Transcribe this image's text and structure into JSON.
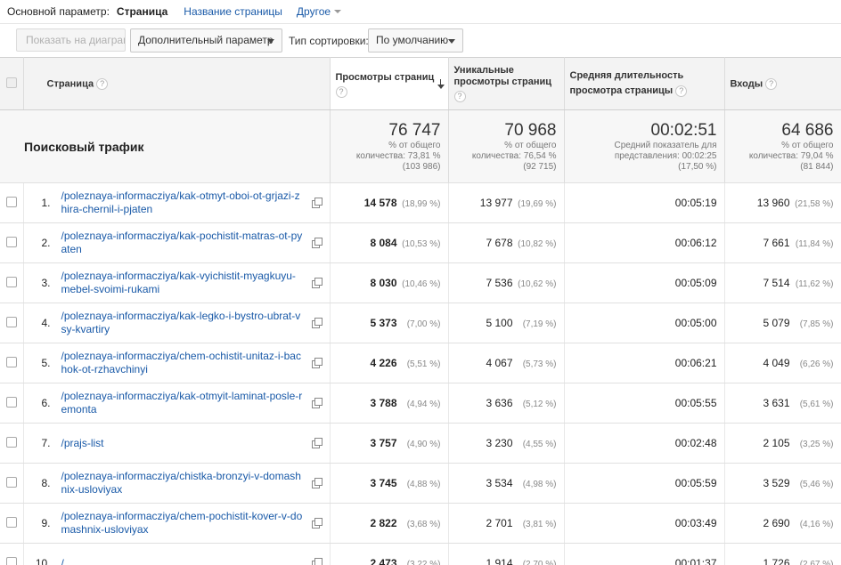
{
  "primary_dimension": {
    "label": "Основной параметр:",
    "active": "Страница",
    "link_title": "Название страницы",
    "other": "Другое"
  },
  "toolbar": {
    "show_on_chart": "Показать на диаграмме",
    "secondary_dimension": "Дополнительный параметр",
    "sort_type_label": "Тип сортировки:",
    "sort_type_value": "По умолчанию"
  },
  "columns": {
    "page": "Страница",
    "pageviews": "Просмотры страниц",
    "unique_pageviews": "Уникальные просмотры страниц",
    "avg_time": "Средняя длительность просмотра страницы",
    "entrances": "Входы"
  },
  "summary": {
    "title": "Поисковый трафик",
    "pageviews": {
      "value": "76 747",
      "sub1": "% от общего",
      "sub2": "количества: 73,81 %",
      "sub3": "(103 986)"
    },
    "unique": {
      "value": "70 968",
      "sub1": "% от общего",
      "sub2": "количества: 76,54 %",
      "sub3": "(92 715)"
    },
    "avg_time": {
      "value": "00:02:51",
      "sub1": "Средний показатель для",
      "sub2": "представления: 00:02:25",
      "sub3": "(17,50 %)"
    },
    "entrances": {
      "value": "64 686",
      "sub1": "% от общего",
      "sub2": "количества: 79,04 %",
      "sub3": "(81 844)"
    }
  },
  "rows": [
    {
      "num": "1.",
      "page": "/poleznaya-informacziya/kak-otmyt-oboi-ot-grjazi-zhira-chernil-i-pjaten",
      "pv": "14 578",
      "pv_pct": "(18,99 %)",
      "upv": "13 977",
      "upv_pct": "(19,69 %)",
      "time": "00:05:19",
      "ent": "13 960",
      "ent_pct": "(21,58 %)"
    },
    {
      "num": "2.",
      "page": "/poleznaya-informacziya/kak-pochistit-matras-ot-pyaten",
      "pv": "8 084",
      "pv_pct": "(10,53 %)",
      "upv": "7 678",
      "upv_pct": "(10,82 %)",
      "time": "00:06:12",
      "ent": "7 661",
      "ent_pct": "(11,84 %)"
    },
    {
      "num": "3.",
      "page": "/poleznaya-informacziya/kak-vyichistit-myagkuyu-mebel-svoimi-rukami",
      "pv": "8 030",
      "pv_pct": "(10,46 %)",
      "upv": "7 536",
      "upv_pct": "(10,62 %)",
      "time": "00:05:09",
      "ent": "7 514",
      "ent_pct": "(11,62 %)"
    },
    {
      "num": "4.",
      "page": "/poleznaya-informacziya/kak-legko-i-bystro-ubrat-vsy-kvartiry",
      "pv": "5 373",
      "pv_pct": "(7,00 %)",
      "upv": "5 100",
      "upv_pct": "(7,19 %)",
      "time": "00:05:00",
      "ent": "5 079",
      "ent_pct": "(7,85 %)"
    },
    {
      "num": "5.",
      "page": "/poleznaya-informacziya/chem-ochistit-unitaz-i-bachok-ot-rzhavchinyi",
      "pv": "4 226",
      "pv_pct": "(5,51 %)",
      "upv": "4 067",
      "upv_pct": "(5,73 %)",
      "time": "00:06:21",
      "ent": "4 049",
      "ent_pct": "(6,26 %)"
    },
    {
      "num": "6.",
      "page": "/poleznaya-informacziya/kak-otmyit-laminat-posle-remonta",
      "pv": "3 788",
      "pv_pct": "(4,94 %)",
      "upv": "3 636",
      "upv_pct": "(5,12 %)",
      "time": "00:05:55",
      "ent": "3 631",
      "ent_pct": "(5,61 %)"
    },
    {
      "num": "7.",
      "page": "/prajs-list",
      "pv": "3 757",
      "pv_pct": "(4,90 %)",
      "upv": "3 230",
      "upv_pct": "(4,55 %)",
      "time": "00:02:48",
      "ent": "2 105",
      "ent_pct": "(3,25 %)"
    },
    {
      "num": "8.",
      "page": "/poleznaya-informacziya/chistka-bronzyi-v-domashnix-usloviyax",
      "pv": "3 745",
      "pv_pct": "(4,88 %)",
      "upv": "3 534",
      "upv_pct": "(4,98 %)",
      "time": "00:05:59",
      "ent": "3 529",
      "ent_pct": "(5,46 %)"
    },
    {
      "num": "9.",
      "page": "/poleznaya-informacziya/chem-pochistit-kover-v-domashnix-usloviyax",
      "pv": "2 822",
      "pv_pct": "(3,68 %)",
      "upv": "2 701",
      "upv_pct": "(3,81 %)",
      "time": "00:03:49",
      "ent": "2 690",
      "ent_pct": "(4,16 %)"
    },
    {
      "num": "10.",
      "page": "/",
      "pv": "2 473",
      "pv_pct": "(3,22 %)",
      "upv": "1 914",
      "upv_pct": "(2,70 %)",
      "time": "00:01:37",
      "ent": "1 726",
      "ent_pct": "(2,67 %)"
    }
  ]
}
